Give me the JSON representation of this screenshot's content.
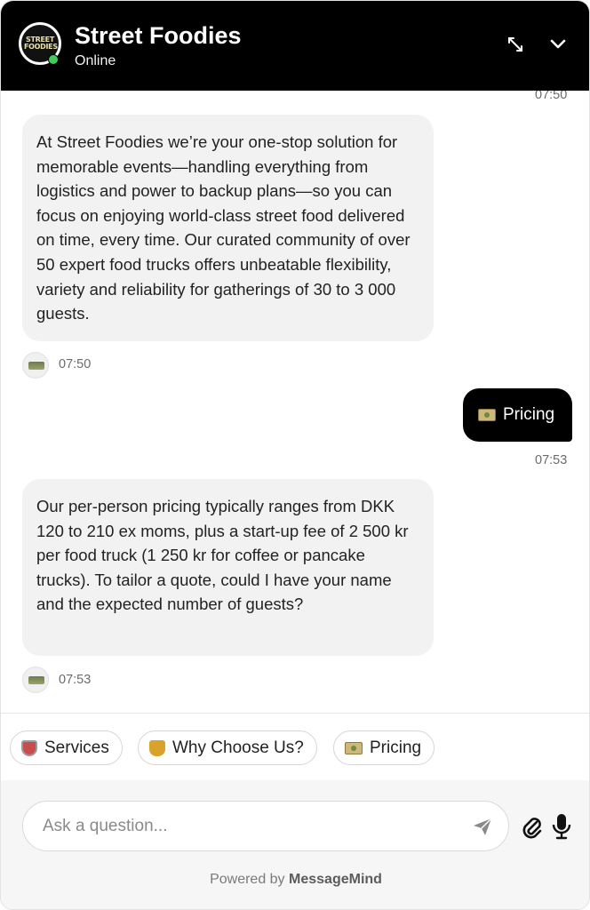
{
  "header": {
    "title": "Street Foodies",
    "status": "Online",
    "logo_text": "STREET FOODIES",
    "status_color": "#3ecf5a"
  },
  "messages": {
    "top_time": "07:50",
    "bot_1": "At Street Foodies we’re your one-stop solution for memorable events—handling everything from logistics and power to backup plans—so you can focus on enjoying world-class street food delivered on time, every time. Our curated community of over 50 expert food trucks offers unbeatable flexibility, variety and reliability for gatherings of 30 to 3 000 guests.",
    "bot_1_time": "07:50",
    "user_1": "Pricing",
    "user_1_time": "07:53",
    "bot_2": "Our per-person pricing typically ranges from DKK 120 to 210 ex moms, plus a start-up fee of 2 500 kr per food truck (1 250 kr for coffee or pancake trucks). To tailor a quote, could I have your name and the expected number of guests?",
    "bot_2_time": "07:53"
  },
  "quick_replies": [
    {
      "label": "Services",
      "icon": "shield-icon"
    },
    {
      "label": "Why Choose Us?",
      "icon": "trophy-icon"
    },
    {
      "label": "Pricing",
      "icon": "money-icon"
    }
  ],
  "composer": {
    "placeholder": "Ask a question...",
    "send_icon": "send-icon",
    "attach_icon": "paperclip-icon",
    "mic_icon": "microphone-icon"
  },
  "footer": {
    "powered_prefix": "Powered by",
    "brand": "MessageMind"
  }
}
